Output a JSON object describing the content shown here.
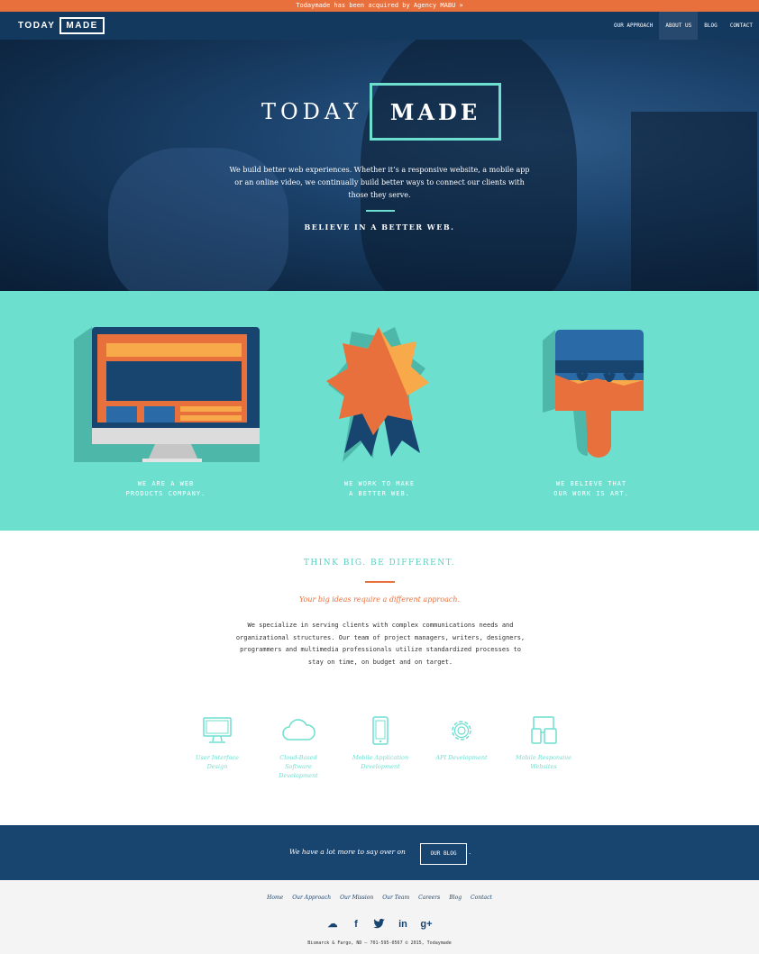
{
  "announcement": "Todaymade has been acquired by Agency MABU »",
  "nav": {
    "logo_left": "TODAY",
    "logo_right": "MADE",
    "links": [
      "OUR APPROACH",
      "ABOUT US",
      "BLOG",
      "CONTACT"
    ],
    "active": "ABOUT US"
  },
  "hero": {
    "title_left": "TODAY",
    "title_right": "MADE",
    "text": "We build better web experiences. Whether it’s a responsive website, a mobile app or an online video, we continually build better ways to connect our clients with those they serve.",
    "tagline": "BELIEVE IN A BETTER WEB."
  },
  "features": [
    {
      "caption": "WE ARE A WEB\nPRODUCTS COMPANY.",
      "icon": "monitor-icon"
    },
    {
      "caption": "WE WORK TO MAKE\nA BETTER WEB.",
      "icon": "award-ribbon-icon"
    },
    {
      "caption": "WE BELIEVE THAT\nOUR WORK IS ART.",
      "icon": "paint-brush-icon"
    }
  ],
  "about": {
    "heading": "THINK BIG. BE DIFFERENT.",
    "subheading": "Your big ideas require a different approach.",
    "body": "We specialize in serving clients with complex communications needs and organizational structures. Our team of project managers, writers, designers, programmers and multimedia professionals utilize standardized processes to stay on time, on budget and on target."
  },
  "services": [
    {
      "label": "User Interface\nDesign",
      "icon": "monitor-outline-icon"
    },
    {
      "label": "Cloud-Based\nSoftware\nDevelopment",
      "icon": "cloud-icon"
    },
    {
      "label": "Mobile Application\nDevelopment",
      "icon": "phone-icon"
    },
    {
      "label": "API Development",
      "icon": "gear-icon"
    },
    {
      "label": "Mobile Responsive\nWebsites",
      "icon": "devices-icon"
    }
  ],
  "blog_cta": {
    "text": "We have a lot more to say over on",
    "button": "OUR BLOG",
    "trail": "."
  },
  "footer": {
    "links": [
      "Home",
      "Our Approach",
      "Our Mission",
      "Our Team",
      "Careers",
      "Blog",
      "Contact"
    ],
    "social": [
      {
        "name": "cloud-icon",
        "glyph": "☁"
      },
      {
        "name": "facebook-icon",
        "glyph": "f"
      },
      {
        "name": "twitter-icon",
        "glyph": "🐦"
      },
      {
        "name": "linkedin-icon",
        "glyph": "in"
      },
      {
        "name": "google-plus-icon",
        "glyph": "g+"
      }
    ],
    "copyright": "Bismarck & Fargo, ND — 701-595-0567 © 2015, Todaymade"
  },
  "colors": {
    "orange": "#e8703c",
    "navy": "#14395f",
    "teal": "#6ddfcf",
    "yellow": "#f8a94a"
  }
}
